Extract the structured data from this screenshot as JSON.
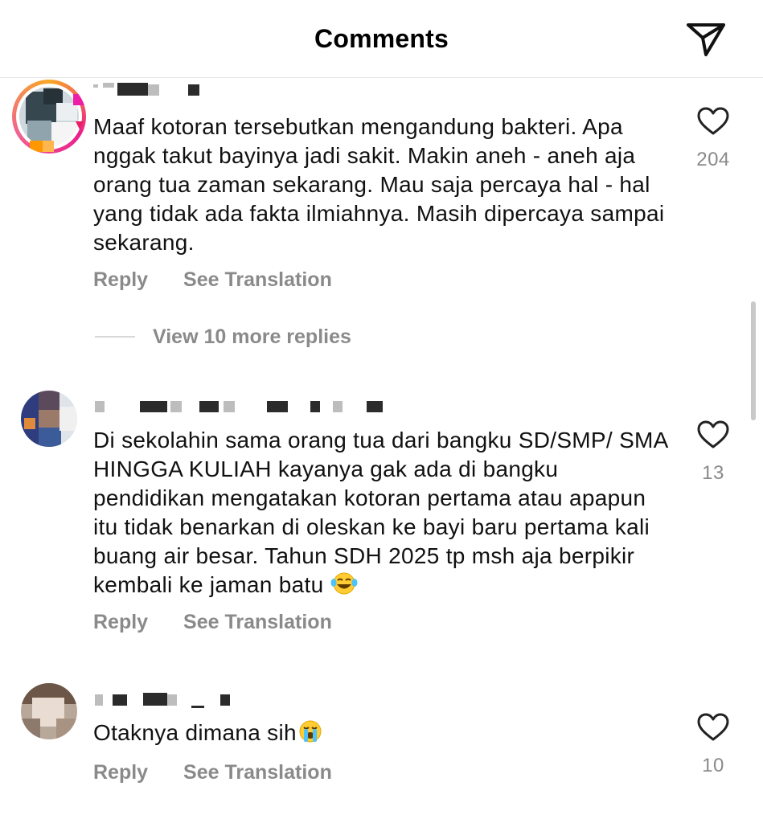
{
  "header": {
    "title": "Comments",
    "share_icon": "paper-plane-icon"
  },
  "comments": [
    {
      "text": "Maaf kotoran tersebutkan mengandung bakteri. Apa nggak takut bayinya jadi sakit. Makin aneh - aneh aja orang tua zaman sekarang. Mau saja percaya hal - hal yang tidak ada fakta ilmiahnya. Masih dipercaya sampai sekarang.",
      "likes": "204",
      "reply_label": "Reply",
      "translate_label": "See Translation",
      "view_replies_label": "View 10 more replies"
    },
    {
      "text": "Di sekolahin sama orang tua dari bangku SD/SMP/ SMA HINGGA KULIAH kayanya gak ada di bangku pendidikan mengatakan kotoran pertama atau apapun itu tidak benarkan di oleskan ke bayi baru pertama kali buang air besar. Tahun SDH 2025 tp msh aja berpikir kembali ke jaman batu",
      "emoji": "face-with-tears-of-joy",
      "likes": "13",
      "reply_label": "Reply",
      "translate_label": "See Translation"
    },
    {
      "text": "Otaknya dimana sih",
      "emoji": "loudly-crying-face",
      "likes": "10",
      "reply_label": "Reply",
      "translate_label": "See Translation"
    }
  ],
  "colors": {
    "text": "#111111",
    "secondary": "#8a8a8a",
    "divider": "#e6e6e6",
    "story_ring_start": "#f9a825",
    "story_ring_end": "#e91e8c"
  }
}
